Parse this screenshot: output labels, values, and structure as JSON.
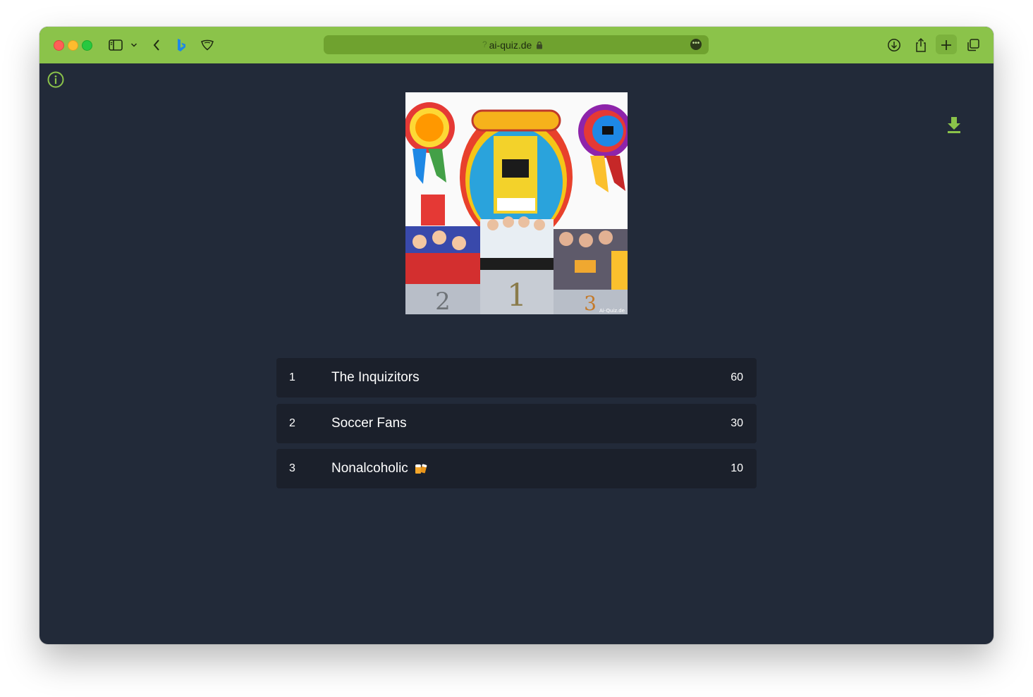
{
  "browser": {
    "url": "ai-quiz.de",
    "theme_color": "#8bc34a",
    "icons": [
      "sidebar-toggle-icon",
      "chevron-down-icon",
      "back-chevron-icon",
      "bing-icon",
      "shield-icon",
      "lock-icon",
      "more-icon",
      "download-icon",
      "share-icon",
      "plus-icon",
      "tabs-overview-icon"
    ]
  },
  "page": {
    "background": "#222a39",
    "accent": "#8bc34a",
    "info_icon": "info-icon",
    "download_icon": "download-icon",
    "image_watermark": "Ai-Quiz.de",
    "podium_labels": [
      "2",
      "1",
      "3"
    ]
  },
  "scoreboard": [
    {
      "rank": "1",
      "team": "The Inquizitors",
      "points": "60",
      "emoji": ""
    },
    {
      "rank": "2",
      "team": "Soccer Fans",
      "points": "30",
      "emoji": ""
    },
    {
      "rank": "3",
      "team": "Nonalcoholic",
      "points": "10",
      "emoji": "beer-mugs-icon"
    }
  ]
}
